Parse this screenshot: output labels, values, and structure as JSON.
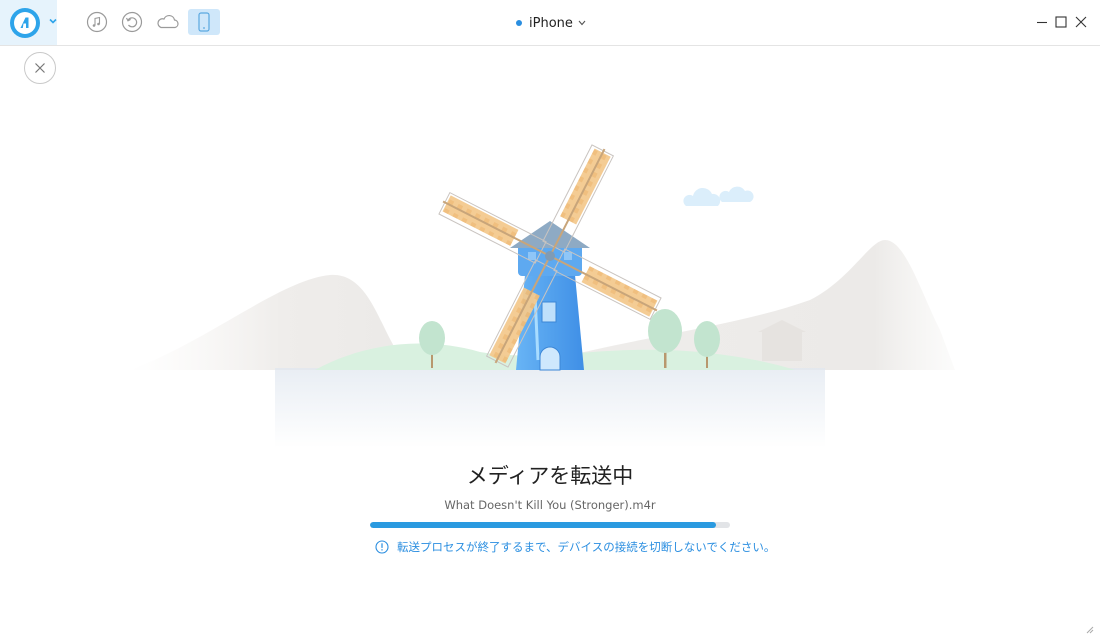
{
  "titlebar": {
    "logo_icon": "app-logo-icon",
    "toolbar_icons": [
      "music-note-icon",
      "restore-icon",
      "cloud-icon",
      "phone-icon"
    ],
    "device_name": "iPhone",
    "device_status_color": "#2a8ee0",
    "window_controls": [
      "minimize-icon",
      "maximize-icon",
      "close-icon"
    ]
  },
  "transfer": {
    "heading": "メディアを転送中",
    "filename": "What Doesn't Kill You (Stronger).m4r",
    "progress": 0.96,
    "notice": "転送プロセスが終了するまで、デバイスの接続を切断しないでください。",
    "accent_color": "#2a9ae0"
  }
}
